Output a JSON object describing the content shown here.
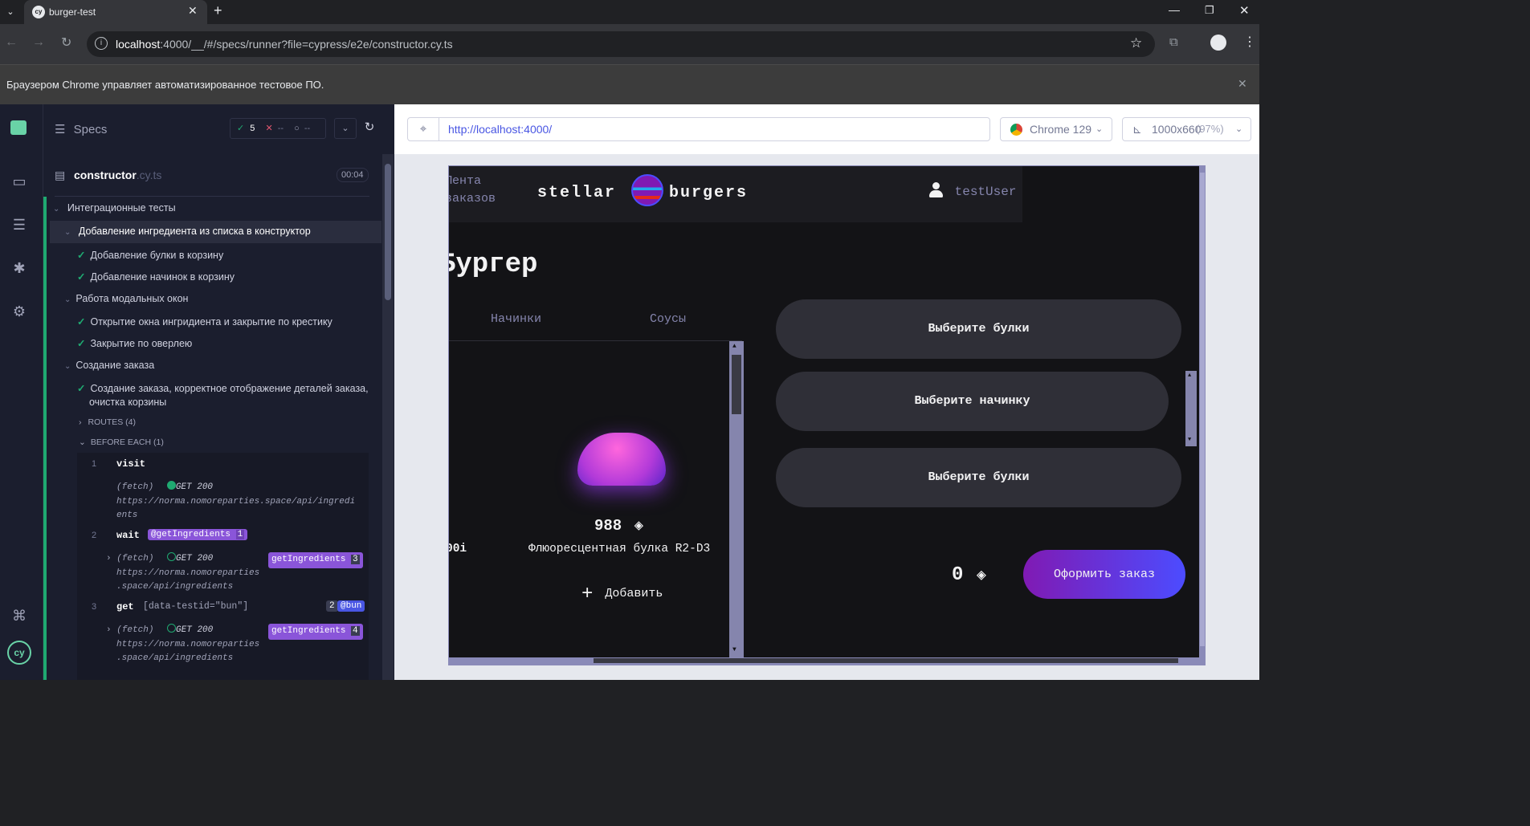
{
  "browser": {
    "tab_title": "burger-test",
    "url_host": "localhost",
    "url_rest": ":4000/__/#/specs/runner?file=cypress/e2e/constructor.cy.ts",
    "infobar_text": "Браузером Chrome управляет автоматизированное тестовое ПО."
  },
  "reporter": {
    "specs_label": "Specs",
    "passed": "5",
    "failed": "--",
    "pending": "--",
    "spec_name": "constructor",
    "spec_ext": ".cy.ts",
    "duration": "00:04",
    "suite_root": "Интеграционные тесты",
    "suites": [
      {
        "title": "Добавление ингредиента из списка в конструктор",
        "tests": [
          "Добавление булки в корзину",
          "Добавление начинок в корзину"
        ]
      },
      {
        "title": "Работа модальных окон",
        "tests": [
          "Открытие окна ингридиента и закрытие по крестику",
          "Закрытие по оверлею"
        ]
      },
      {
        "title": "Создание заказа",
        "tests": [
          "Создание заказа, корректное отображение деталей заказа,",
          "очистка корзины"
        ]
      }
    ],
    "routes_label": "ROUTES (4)",
    "before_each_label": "BEFORE EACH (1)",
    "commands": [
      {
        "n": "1",
        "name": "visit"
      },
      {
        "fetch": "(fetch)",
        "status": "GET 200",
        "url1": "https://norma.nomoreparties.space/api/ingredi",
        "url2": "ents"
      },
      {
        "n": "2",
        "name": "wait",
        "alias": "@getIngredients",
        "count": "1"
      },
      {
        "fetch": "(fetch)",
        "status": "GET 200",
        "alias": "getIngredients",
        "count": "3",
        "url1": "https://norma.nomoreparties",
        "url2": ".space/api/ingredients"
      },
      {
        "n": "3",
        "name": "get",
        "selector": "[data-testid=\"bun\"]",
        "count": "2",
        "alias": "@bun"
      },
      {
        "fetch": "(fetch)",
        "status": "GET 200",
        "alias": "getIngredients",
        "count": "4",
        "url1": "https://norma.nomoreparties",
        "url2": ".space/api/ingredients"
      }
    ]
  },
  "aut": {
    "url": "http://localhost:4000/",
    "browser": "Chrome 129",
    "viewport": "1000x660",
    "scale": "(97%)"
  },
  "app": {
    "feed_line1": "Лента",
    "feed_line2": "заказов",
    "logo_left": "stellar",
    "logo_right": "burgers",
    "user": "testUser",
    "heading": "Бургер",
    "tabs": [
      "Начинки",
      "Соусы"
    ],
    "price": "988",
    "price_partial": "00i",
    "ingredient_name": "Флюоресцентная булка R2-D3",
    "add_label": "Добавить",
    "slots": [
      "Выберите булки",
      "Выберите начинку",
      "Выберите булки"
    ],
    "total": "0",
    "order_button": "Оформить заказ",
    "colors": {
      "accent": "#4c4cff",
      "badge": "#8a55d9",
      "pass": "#1fa971"
    }
  }
}
